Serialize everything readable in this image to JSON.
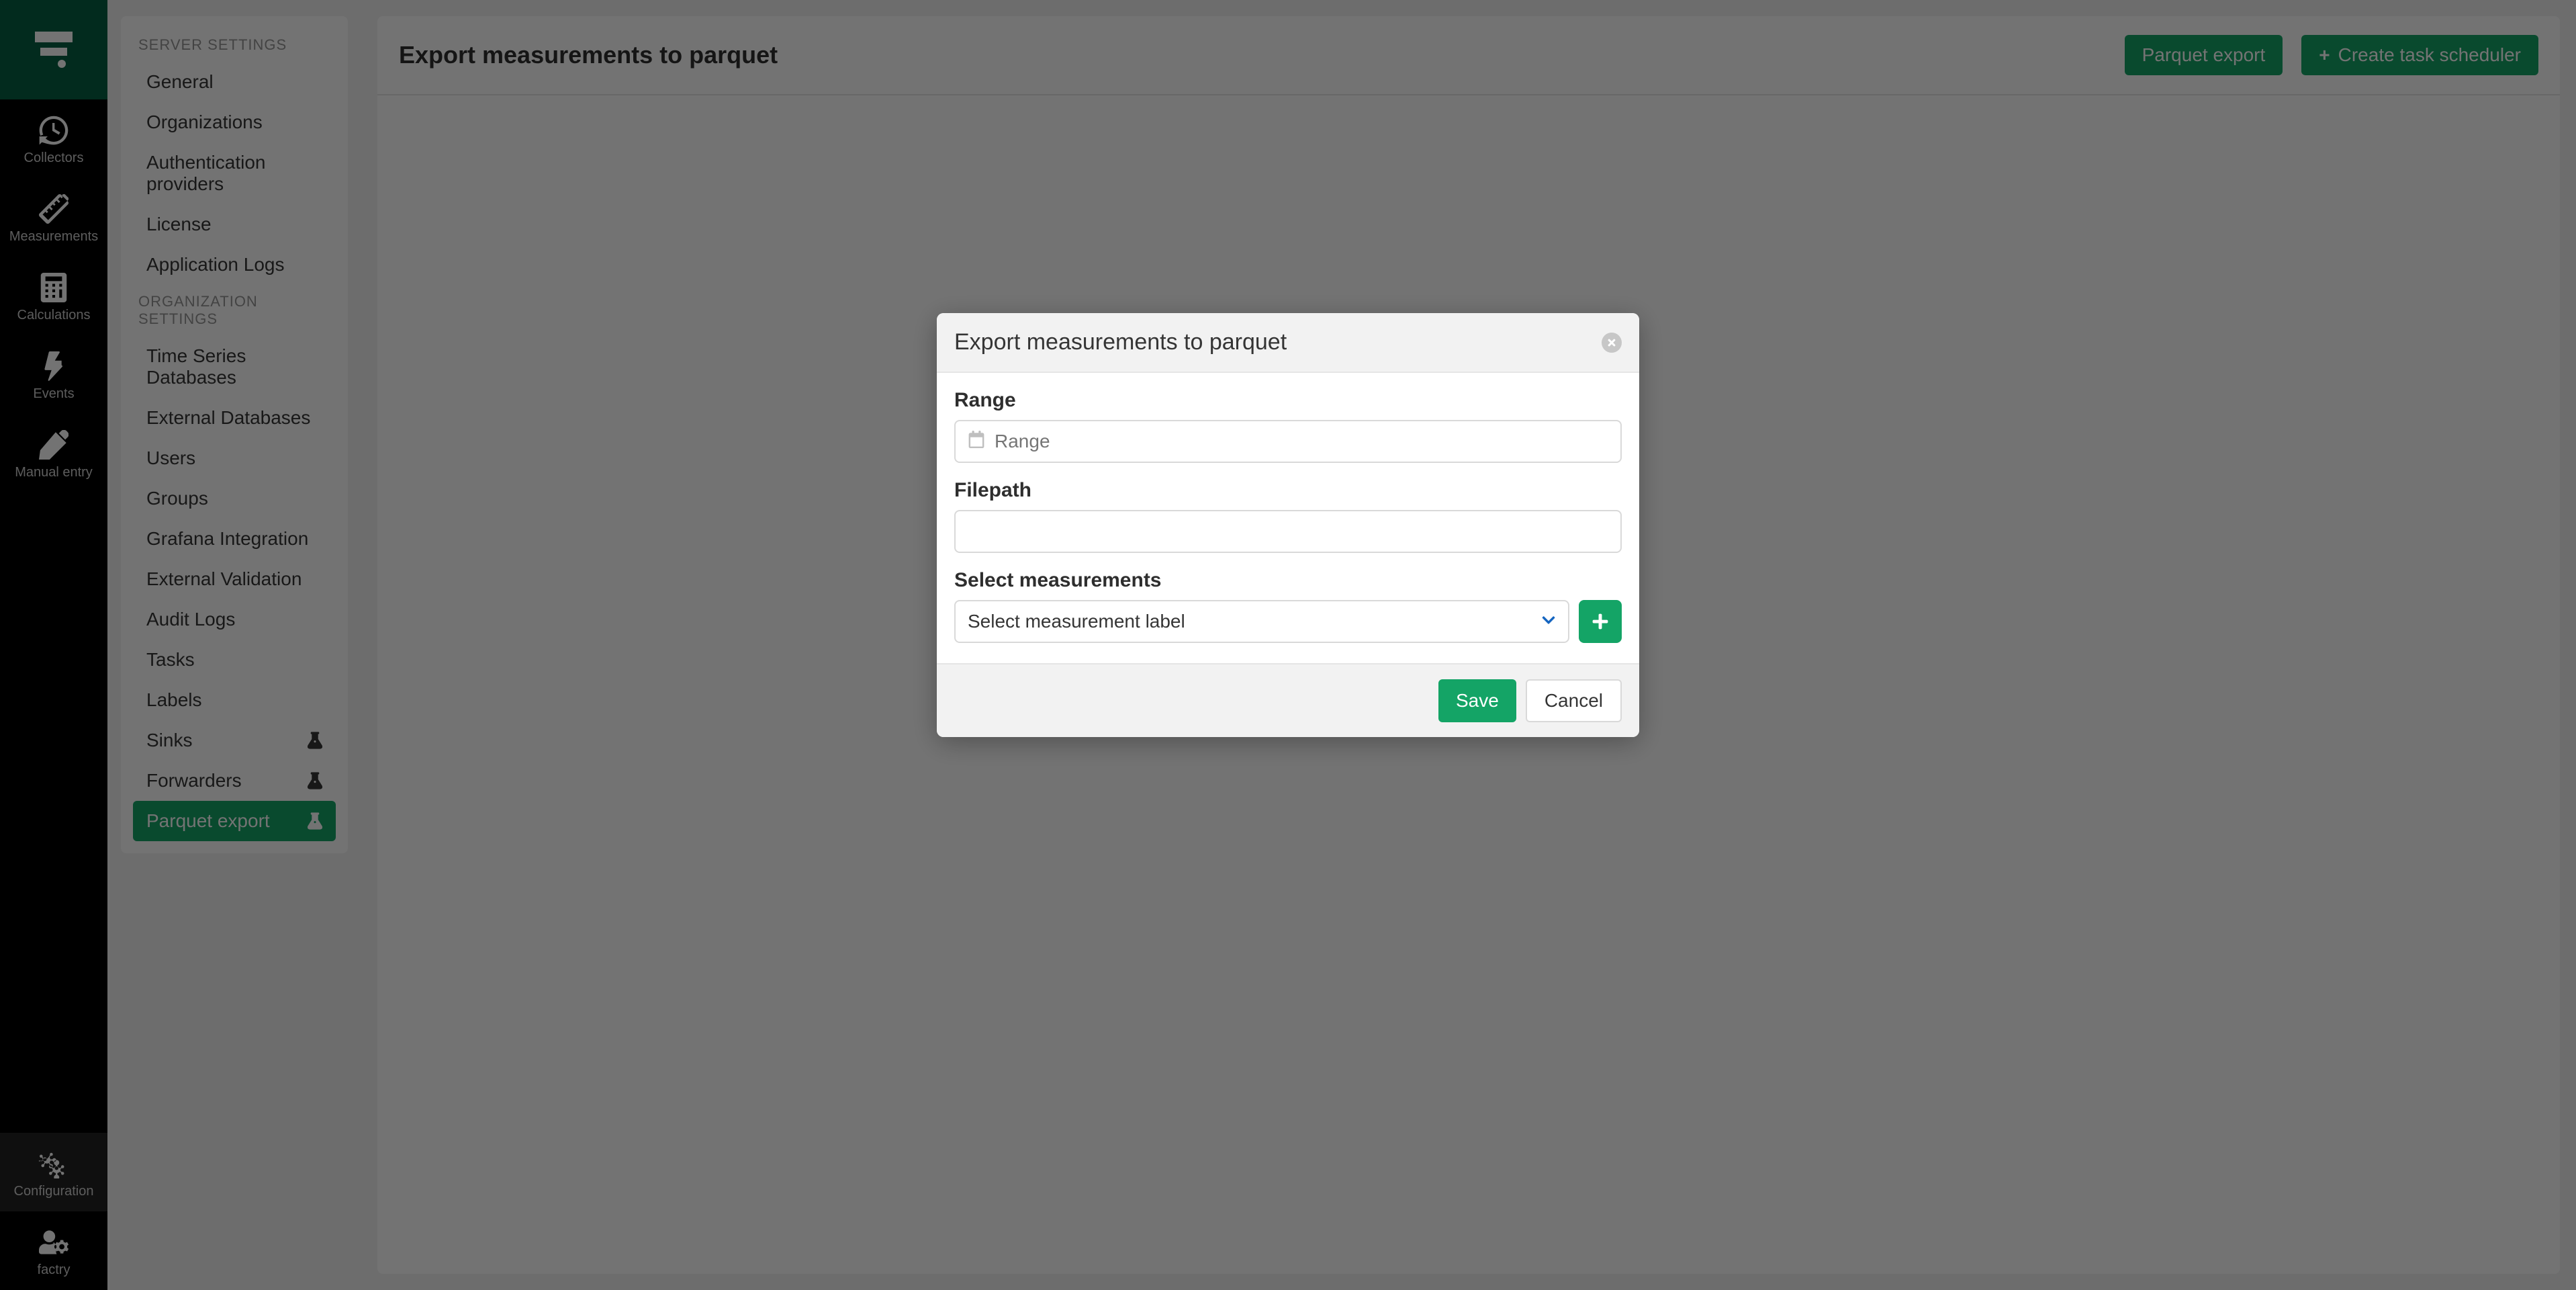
{
  "rail": {
    "items": [
      {
        "id": "collectors",
        "label": "Collectors"
      },
      {
        "id": "measurements",
        "label": "Measurements"
      },
      {
        "id": "calculations",
        "label": "Calculations"
      },
      {
        "id": "events",
        "label": "Events"
      },
      {
        "id": "manual-entry",
        "label": "Manual entry"
      }
    ],
    "bottom": [
      {
        "id": "configuration",
        "label": "Configuration"
      },
      {
        "id": "factry",
        "label": "factry"
      }
    ]
  },
  "settings": {
    "section1_title": "SERVER SETTINGS",
    "section1": [
      "General",
      "Organizations",
      "Authentication providers",
      "License",
      "Application Logs"
    ],
    "section2_title": "ORGANIZATION SETTINGS",
    "section2": [
      {
        "label": "Time Series Databases",
        "flask": false
      },
      {
        "label": "External Databases",
        "flask": false
      },
      {
        "label": "Users",
        "flask": false
      },
      {
        "label": "Groups",
        "flask": false
      },
      {
        "label": "Grafana Integration",
        "flask": false
      },
      {
        "label": "External Validation",
        "flask": false
      },
      {
        "label": "Audit Logs",
        "flask": false
      },
      {
        "label": "Tasks",
        "flask": false
      },
      {
        "label": "Labels",
        "flask": false
      },
      {
        "label": "Sinks",
        "flask": true
      },
      {
        "label": "Forwarders",
        "flask": true
      },
      {
        "label": "Parquet export",
        "flask": true,
        "active": true
      }
    ]
  },
  "page": {
    "title": "Export measurements to parquet",
    "buttons": {
      "parquet_export": "Parquet export",
      "create_scheduler": "Create task scheduler"
    }
  },
  "modal": {
    "title": "Export measurements to parquet",
    "labels": {
      "range": "Range",
      "filepath": "Filepath",
      "select_measurements": "Select measurements"
    },
    "placeholders": {
      "range": "Range",
      "filepath": "",
      "select_measurement": "Select measurement label"
    },
    "buttons": {
      "save": "Save",
      "cancel": "Cancel"
    }
  }
}
